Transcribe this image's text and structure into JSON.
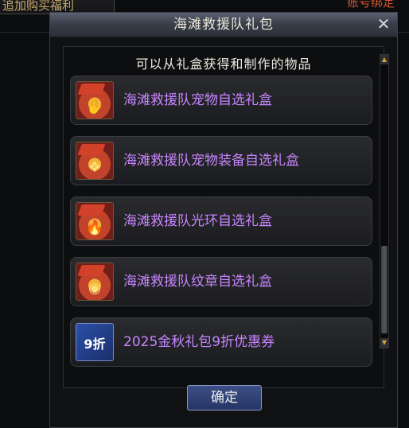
{
  "background": {
    "left_tab": "追加购买福利",
    "right_tab": "账号绑定"
  },
  "window": {
    "title": "海滩救援队礼包",
    "close_glyph": "✕",
    "subtitle": "可以从礼盒获得和制作的物品",
    "items": [
      {
        "name": "海滩救援队宠物自选礼盒",
        "icon": "pet-gift-box-icon",
        "symbol": "✋"
      },
      {
        "name": "海滩救援队宠物装备自选礼盒",
        "icon": "pet-equipment-gift-box-icon",
        "symbol": "❖"
      },
      {
        "name": "海滩救援队光环自选礼盒",
        "icon": "aura-gift-box-icon",
        "symbol": "🔥"
      },
      {
        "name": "海滩救援队纹章自选礼盒",
        "icon": "emblem-gift-box-icon",
        "symbol": "◉"
      },
      {
        "name": "2025金秋礼包9折优惠券",
        "icon": "discount-voucher-icon",
        "symbol": "9折"
      }
    ],
    "confirm_label": "确定"
  }
}
